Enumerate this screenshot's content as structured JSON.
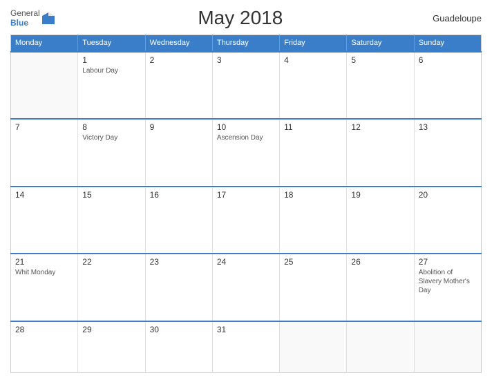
{
  "header": {
    "logo_general": "General",
    "logo_blue": "Blue",
    "title": "May 2018",
    "country": "Guadeloupe"
  },
  "columns": [
    "Monday",
    "Tuesday",
    "Wednesday",
    "Thursday",
    "Friday",
    "Saturday",
    "Sunday"
  ],
  "weeks": [
    [
      {
        "num": "",
        "event": ""
      },
      {
        "num": "1",
        "event": "Labour Day"
      },
      {
        "num": "2",
        "event": ""
      },
      {
        "num": "3",
        "event": ""
      },
      {
        "num": "4",
        "event": ""
      },
      {
        "num": "5",
        "event": ""
      },
      {
        "num": "6",
        "event": ""
      }
    ],
    [
      {
        "num": "7",
        "event": ""
      },
      {
        "num": "8",
        "event": "Victory Day"
      },
      {
        "num": "9",
        "event": ""
      },
      {
        "num": "10",
        "event": "Ascension Day"
      },
      {
        "num": "11",
        "event": ""
      },
      {
        "num": "12",
        "event": ""
      },
      {
        "num": "13",
        "event": ""
      }
    ],
    [
      {
        "num": "14",
        "event": ""
      },
      {
        "num": "15",
        "event": ""
      },
      {
        "num": "16",
        "event": ""
      },
      {
        "num": "17",
        "event": ""
      },
      {
        "num": "18",
        "event": ""
      },
      {
        "num": "19",
        "event": ""
      },
      {
        "num": "20",
        "event": ""
      }
    ],
    [
      {
        "num": "21",
        "event": "Whit Monday"
      },
      {
        "num": "22",
        "event": ""
      },
      {
        "num": "23",
        "event": ""
      },
      {
        "num": "24",
        "event": ""
      },
      {
        "num": "25",
        "event": ""
      },
      {
        "num": "26",
        "event": ""
      },
      {
        "num": "27",
        "event": "Abolition of Slavery\nMother's Day"
      }
    ],
    [
      {
        "num": "28",
        "event": ""
      },
      {
        "num": "29",
        "event": ""
      },
      {
        "num": "30",
        "event": ""
      },
      {
        "num": "31",
        "event": ""
      },
      {
        "num": "",
        "event": ""
      },
      {
        "num": "",
        "event": ""
      },
      {
        "num": "",
        "event": ""
      }
    ]
  ]
}
